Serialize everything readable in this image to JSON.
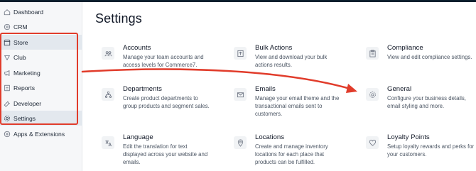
{
  "sidebar": {
    "items": [
      {
        "label": "Dashboard",
        "icon": "home-icon"
      },
      {
        "label": "CRM",
        "icon": "crm-icon"
      },
      {
        "label": "Store",
        "icon": "store-icon"
      },
      {
        "label": "Club",
        "icon": "club-icon"
      },
      {
        "label": "Marketing",
        "icon": "megaphone-icon"
      },
      {
        "label": "Reports",
        "icon": "reports-icon"
      },
      {
        "label": "Developer",
        "icon": "wrench-icon"
      },
      {
        "label": "Settings",
        "icon": "gear-icon"
      },
      {
        "label": "Apps & Extensions",
        "icon": "apps-icon"
      }
    ],
    "active": "Settings"
  },
  "main": {
    "title": "Settings",
    "cards": [
      {
        "title": "Accounts",
        "description": "Manage your team accounts and access levels for Commerce7.",
        "icon": "users-icon"
      },
      {
        "title": "Bulk Actions",
        "description": "View and download your bulk actions results.",
        "icon": "upload-icon"
      },
      {
        "title": "Compliance",
        "description": "View and edit compliance settings.",
        "icon": "clipboard-icon"
      },
      {
        "title": "Departments",
        "description": "Create product departments to group products and segment sales.",
        "icon": "org-chart-icon"
      },
      {
        "title": "Emails",
        "description": "Manage your email theme and the transactional emails sent to customers.",
        "icon": "envelope-icon"
      },
      {
        "title": "General",
        "description": "Configure your business details, email styling and more.",
        "icon": "gear-icon"
      },
      {
        "title": "Language",
        "description": "Edit the translation for text displayed across your website and emails.",
        "icon": "translate-icon"
      },
      {
        "title": "Locations",
        "description": "Create and manage inventory locations for each place that products can be fulfilled.",
        "icon": "map-pin-icon"
      },
      {
        "title": "Loyalty Points",
        "description": "Setup loyalty rewards and perks for your customers.",
        "icon": "heart-icon"
      }
    ]
  },
  "colors": {
    "annotation": "#e13c2b",
    "sidebar_bg": "#f6f7f9",
    "active_bg": "#e3e8ee",
    "topbar": "#0b1e2d"
  }
}
